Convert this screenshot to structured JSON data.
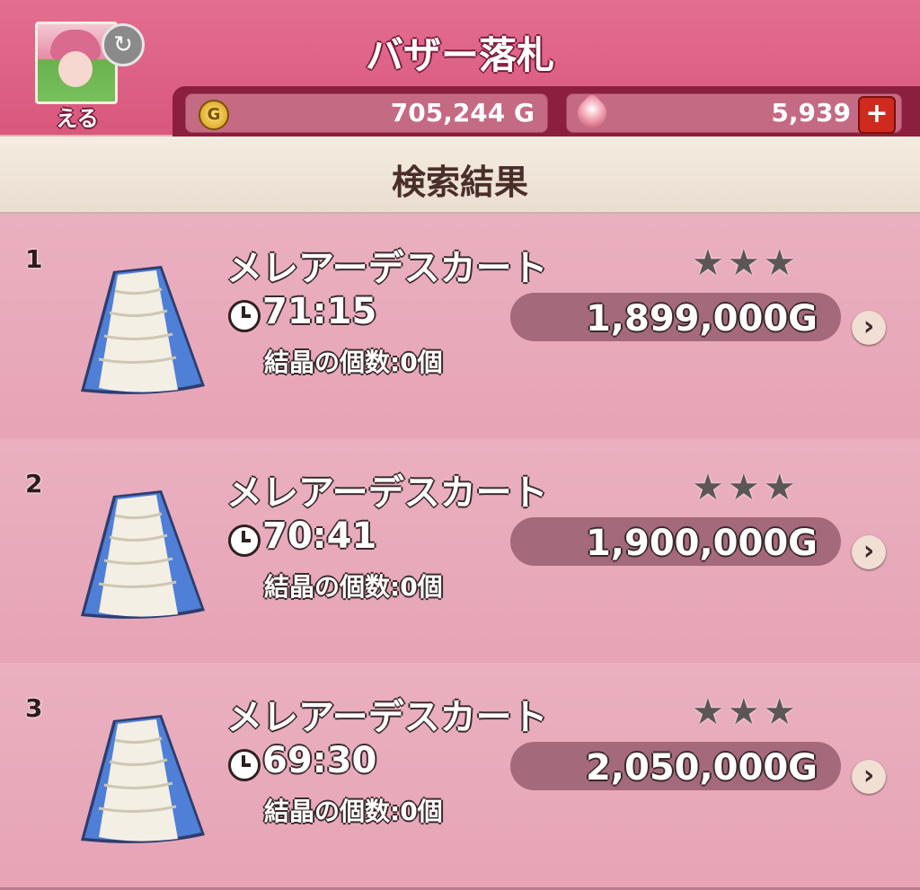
{
  "header": {
    "title": "バザー落札",
    "player_name": "える",
    "gold_value": "705,244 G",
    "gem_value": "5,939",
    "plus_label": "+",
    "swap_icon": "refresh-icon",
    "coin_glyph": "G"
  },
  "section": {
    "title": "検索結果"
  },
  "results": [
    {
      "num": "1",
      "name": "メレアーデスカート",
      "time": "71:15",
      "crystal": "結晶の個数:0個",
      "stars": "★★★",
      "price": "1,899,000G",
      "chevron": "›"
    },
    {
      "num": "2",
      "name": "メレアーデスカート",
      "time": "70:41",
      "crystal": "結晶の個数:0個",
      "stars": "★★★",
      "price": "1,900,000G",
      "chevron": "›"
    },
    {
      "num": "3",
      "name": "メレアーデスカート",
      "time": "69:30",
      "crystal": "結晶の個数:0個",
      "stars": "★★★",
      "price": "2,050,000G",
      "chevron": "›"
    }
  ],
  "colors": {
    "header": "#d8577d",
    "bar": "#8b1f3f",
    "row": "#e8a7b7",
    "skirt_blue": "#4f7fd6",
    "skirt_white": "#f3efe4"
  }
}
